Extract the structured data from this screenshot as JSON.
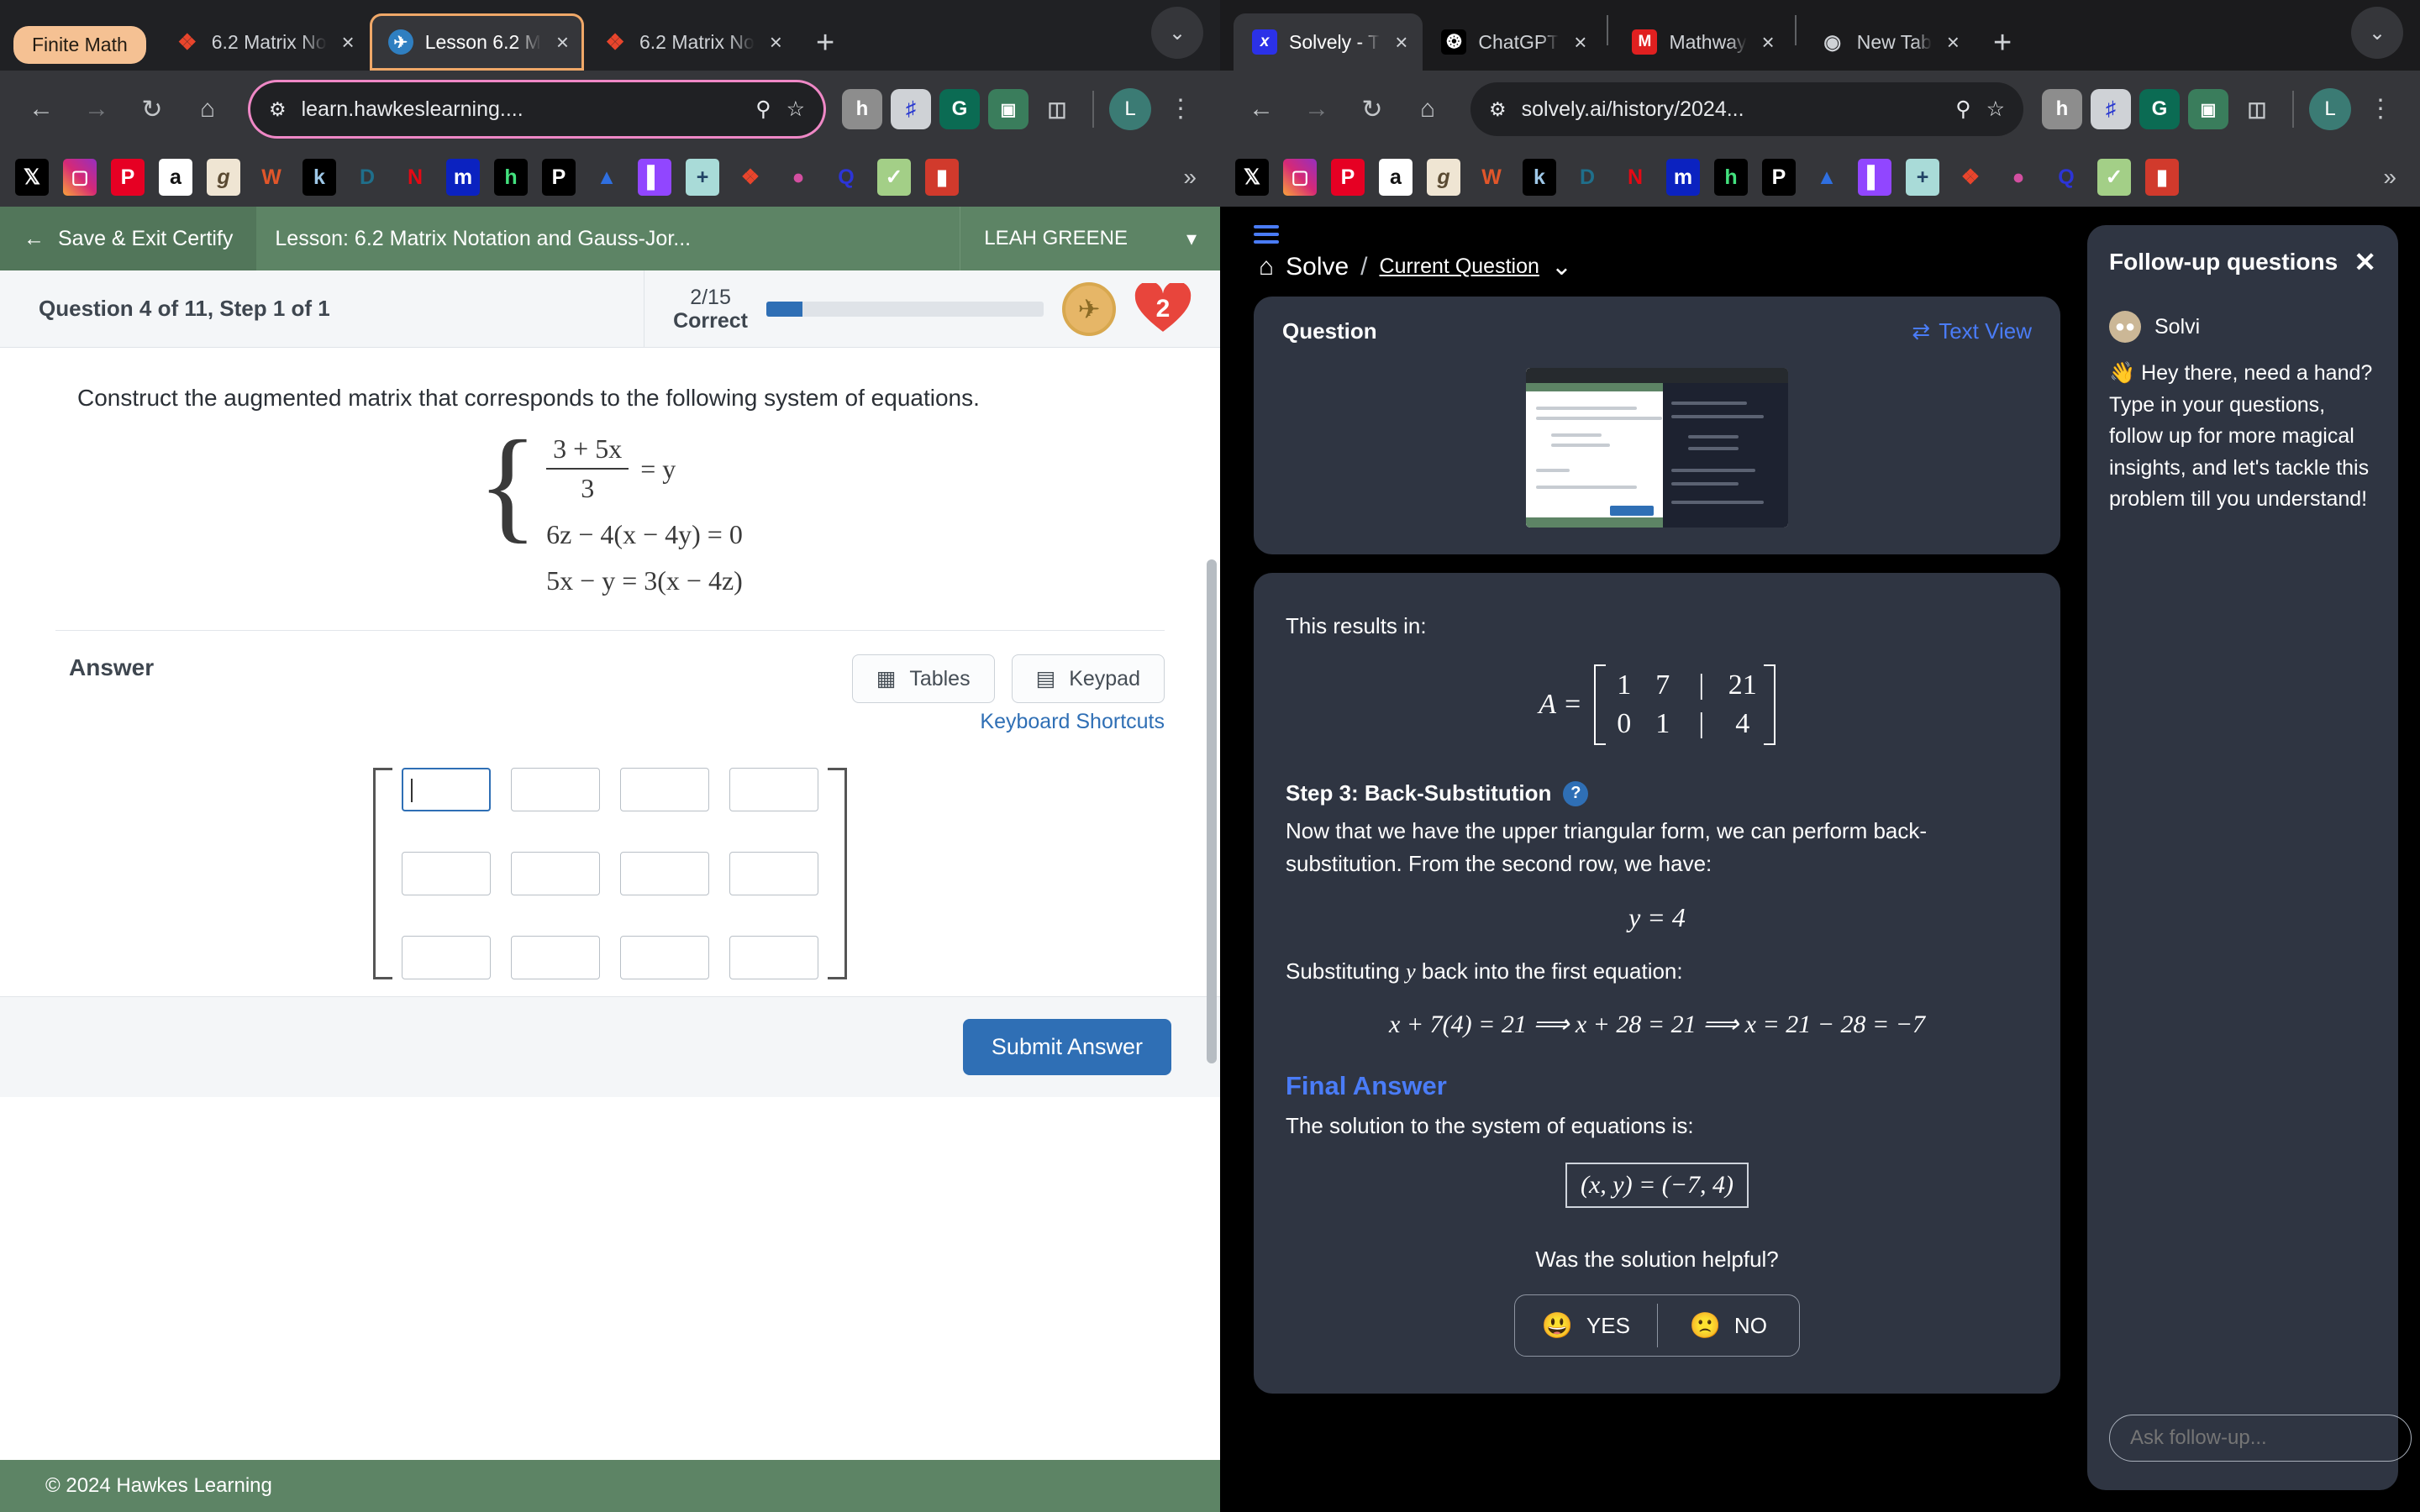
{
  "left_window": {
    "tabs": [
      {
        "label": "Finite Math",
        "type": "pill",
        "favicon": "grid-icon"
      },
      {
        "label": "6.2 Matrix No",
        "favicon": "hawkes-icon",
        "close": "×"
      },
      {
        "label": "Lesson 6.2 M",
        "favicon": "solvely-bird-icon",
        "close": "×",
        "active": true
      },
      {
        "label": "6.2 Matrix No",
        "favicon": "hawkes-icon",
        "close": "×"
      }
    ],
    "new_tab": "+",
    "tab_list_chevron": "⌄",
    "toolbar": {
      "back": "←",
      "forward": "→",
      "reload": "↻",
      "home": "⌂",
      "site_info": "site-info-icon",
      "url": "learn.hawkeslearning....",
      "zoom": "search-icon",
      "bookmark_star": "☆",
      "extensions": [
        "honey-icon",
        "waveform-icon",
        "grammarly-icon",
        "bitwarden-icon",
        "clipboard-icon"
      ],
      "profile_initial": "L",
      "menu": "⋮"
    },
    "bookmarks": [
      "X",
      "Instagram",
      "Pinterest",
      "amazon",
      "goodreads",
      "W",
      "k",
      "D",
      "N",
      "m",
      "h",
      "P",
      "A",
      "twitch",
      "+",
      "hawkes",
      "pin",
      "Q",
      "check",
      "book"
    ],
    "bookmarks_overflow": "»"
  },
  "right_window": {
    "tabs": [
      {
        "label": "Solvely - T",
        "favicon": "solvely-x-icon",
        "close": "×",
        "active": true
      },
      {
        "label": "ChatGPT",
        "favicon": "openai-icon",
        "close": "×"
      },
      {
        "label": "Mathway",
        "favicon": "mathway-icon",
        "close": "×"
      },
      {
        "label": "New Tab",
        "favicon": "chrome-icon",
        "close": "×"
      }
    ],
    "new_tab": "+",
    "tab_list_chevron": "⌄",
    "toolbar": {
      "back": "←",
      "forward": "→",
      "reload": "↻",
      "home": "⌂",
      "url": "solvely.ai/history/2024...",
      "zoom": "search-icon",
      "bookmark_star": "☆",
      "profile_initial": "L",
      "menu": "⋮"
    },
    "bookmarks_overflow": "»"
  },
  "hawkes": {
    "save_exit": "Save & Exit Certify",
    "back_arrow": "←",
    "lesson_title": "Lesson: 6.2 Matrix Notation and Gauss-Jor...",
    "user_name": "LEAH GREENE",
    "user_caret": "▾",
    "question_title": "Question 4 of 11, Step 1 of 1",
    "score_fraction": "2/15",
    "score_label": "Correct",
    "progress_percent": 13,
    "medal_icon": "medal-icon",
    "hearts_count": "2",
    "prompt": "Construct the augmented matrix that corresponds to the following system of equations.",
    "equations": {
      "line1_num": "3 + 5x",
      "line1_den": "3",
      "line1_rhs": "= y",
      "line2": "6z − 4(x − 4y) = 0",
      "line3": "5x − y = 3(x − 4z)"
    },
    "answer_label": "Answer",
    "tables_button": "Tables",
    "keypad_button": "Keypad",
    "keyboard_shortcuts": "Keyboard Shortcuts",
    "matrix_rows": 3,
    "matrix_cols": 4,
    "submit_button": "Submit Answer",
    "footer": "© 2024 Hawkes Learning"
  },
  "solvely": {
    "home_icon": "home-icon",
    "breadcrumb_root": "Solve",
    "breadcrumb_sep": "/",
    "breadcrumb_current": "Current Question",
    "breadcrumb_caret": "⌄",
    "question_card_label": "Question",
    "text_view": "Text View",
    "text_view_icon": "⇄",
    "results_in": "This results in:",
    "matrix_label": "A =",
    "matrix": [
      [
        "1",
        "7",
        "|",
        "21"
      ],
      [
        "0",
        "1",
        "|",
        "4"
      ]
    ],
    "step_title": "Step 3: Back-Substitution",
    "step_help": "?",
    "step_text": "Now that we have the upper triangular form, we can perform back-substitution. From the second row, we have:",
    "eq_y": "y = 4",
    "substituting_text_a": "Substituting ",
    "substituting_var": "y",
    "substituting_text_b": " back into the first equation:",
    "eq_chain": "x + 7(4) = 21  ⟹  x + 28 = 21  ⟹  x = 21 − 28 = −7",
    "final_answer_heading": "Final Answer",
    "final_answer_text": "The solution to the system of equations is:",
    "final_boxed": "(x, y) = (−7, 4)",
    "helpful_question": "Was the solution helpful?",
    "vote_yes": "YES",
    "vote_no": "NO",
    "yes_emoji": "😃",
    "no_emoji": "🙁"
  },
  "followup": {
    "title": "Follow-up questions",
    "close": "✕",
    "bot_name": "Solvi",
    "bot_avatar": "solvi-avatar-icon",
    "greeting": "👋 Hey there, need a hand? Type in your questions, follow up for more magical insights, and let's tackle this problem till you understand!",
    "input_placeholder": "Ask follow-up...",
    "send_icon": "↑"
  },
  "colors": {
    "hawkes_green": "#5d8465",
    "accent_blue": "#2f6fb5",
    "solvely_blue": "#4a7cf7",
    "card_bg": "#2f3542",
    "tab_highlight": "#f0a868",
    "omni_highlight": "#ef88c6"
  }
}
